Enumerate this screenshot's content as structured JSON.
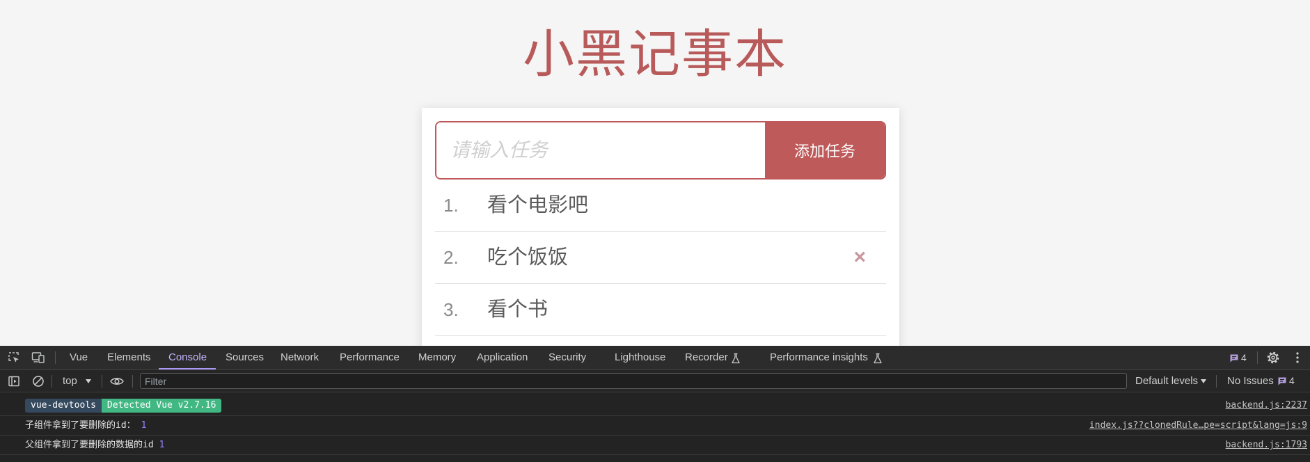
{
  "app": {
    "title": "小黑记事本",
    "input": {
      "placeholder": "请输入任务",
      "value": ""
    },
    "add_button_label": "添加任务",
    "todos": [
      {
        "index": "1.",
        "text": "看个电影吧"
      },
      {
        "index": "2.",
        "text": "吃个饭饭",
        "delete_label": "×",
        "hovered": true
      },
      {
        "index": "3.",
        "text": "看个书"
      }
    ]
  },
  "devtools": {
    "tabs": [
      {
        "label": "Vue",
        "active": false
      },
      {
        "label": "Elements",
        "active": false
      },
      {
        "label": "Console",
        "active": true
      },
      {
        "label": "Sources",
        "active": false
      },
      {
        "label": "Network",
        "active": false
      },
      {
        "label": "Performance",
        "active": false
      },
      {
        "label": "Memory",
        "active": false
      },
      {
        "label": "Application",
        "active": false
      },
      {
        "label": "Security",
        "active": false
      },
      {
        "label": "Lighthouse",
        "active": false
      },
      {
        "label": "Recorder",
        "active": false,
        "experimental": true
      },
      {
        "label": "Performance insights",
        "active": false,
        "experimental": true
      }
    ],
    "issue_badge_count": "4",
    "console_toolbar": {
      "context": "top",
      "filter_placeholder": "Filter",
      "levels": "Default levels",
      "issues_label": "No Issues",
      "issues_count": "4"
    },
    "messages": [
      {
        "badges": [
          "vue-devtools",
          "Detected Vue v2.7.16"
        ],
        "source": "backend.js:2237"
      },
      {
        "text": "子组件拿到了要删除的id：",
        "value": "1",
        "source": "index.js??clonedRule…pe=script&lang=js:9"
      },
      {
        "text": "父组件拿到了要删除的数据的id",
        "value": "1",
        "source": "backend.js:1793"
      }
    ]
  },
  "colors": {
    "accent": "#be5a5a",
    "title": "#b85a5a",
    "page_background": "#f5f5f5",
    "active_tab": "#c2b3fb",
    "vue_badge_dark": "#35495e",
    "vue_badge_green": "#41b883",
    "console_number": "#9980ff"
  },
  "icons": {
    "tabbar_left": [
      "inspect-element-icon",
      "device-toolbar-icon"
    ],
    "tabbar_right": [
      "issues-message-icon",
      "settings-gear-icon",
      "more-options-icon"
    ],
    "experimental": "experiment-flask-icon",
    "toolbar": [
      "console-sidebar-icon",
      "clear-console-icon",
      "dropdown-arrow-icon",
      "live-expression-eye-icon"
    ]
  }
}
